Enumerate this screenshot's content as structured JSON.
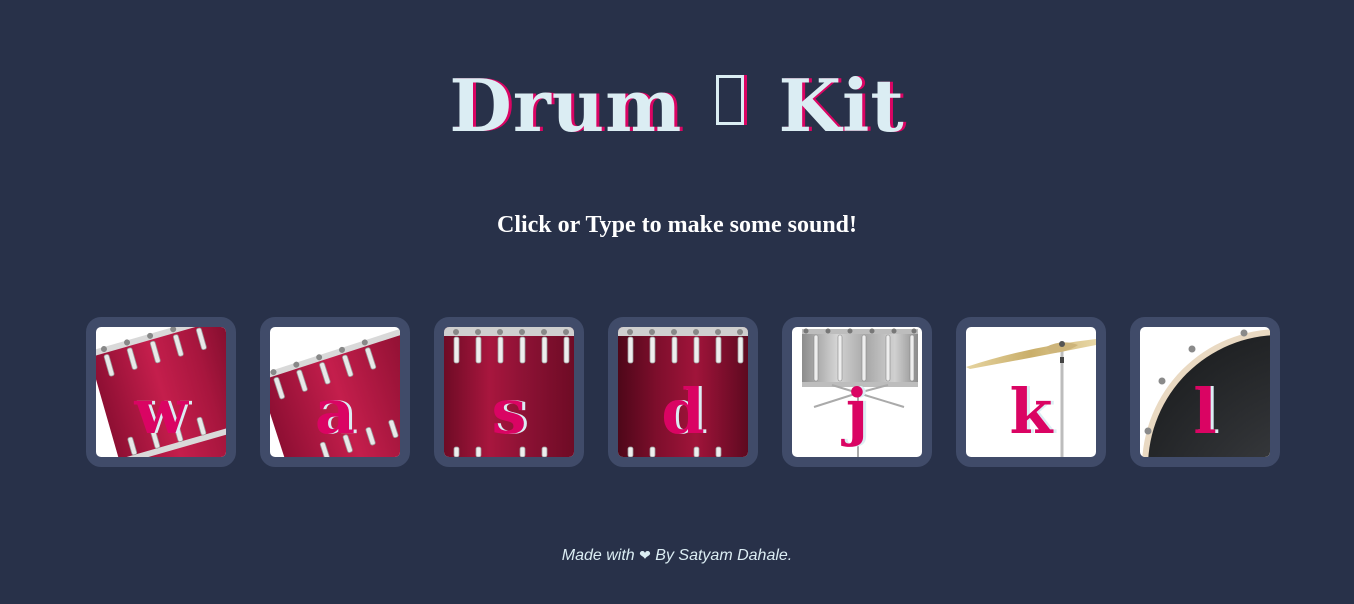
{
  "header": {
    "title_left": "Drum",
    "title_right": "Kit",
    "emoji_icon": "drum-emoji-icon"
  },
  "instructions": "Click or Type to make some sound!",
  "drums": [
    {
      "key": "w",
      "image": "tom-1"
    },
    {
      "key": "a",
      "image": "tom-2"
    },
    {
      "key": "s",
      "image": "tom-3"
    },
    {
      "key": "d",
      "image": "tom-4"
    },
    {
      "key": "j",
      "image": "snare"
    },
    {
      "key": "k",
      "image": "crash"
    },
    {
      "key": "l",
      "image": "kick-bass"
    }
  ],
  "footer": {
    "prefix": "Made with",
    "heart_icon": "heart-icon",
    "heart": "❤",
    "suffix": "By Satyam Dahale."
  },
  "colors": {
    "background": "#283149",
    "tile_border": "#404B69",
    "accent": "#DA0463",
    "title_text": "#DBEDF3"
  }
}
